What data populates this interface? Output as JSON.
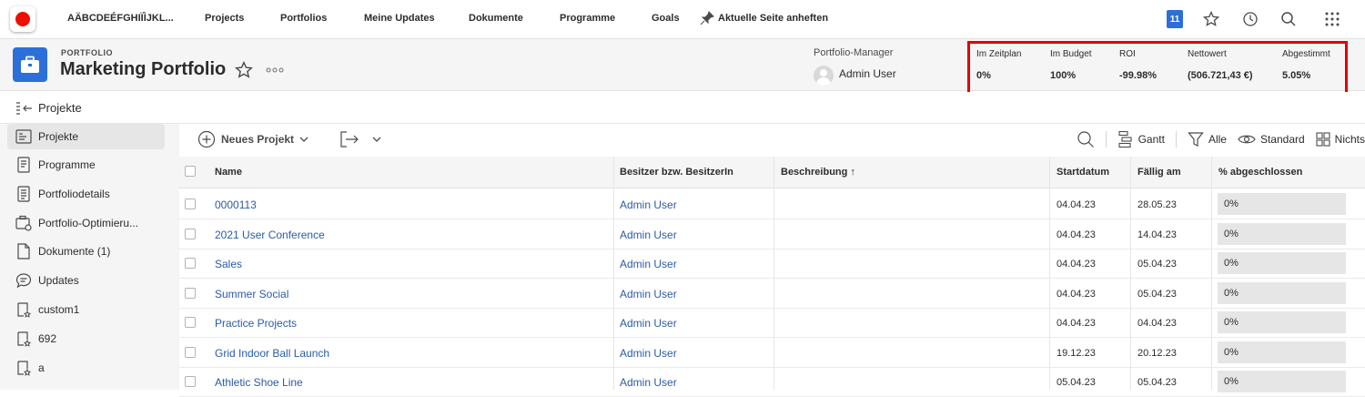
{
  "topnav": {
    "account": "AÄBCDEÉFGHIÏÌJKL...",
    "items": [
      "Projects",
      "Portfolios",
      "Meine Updates",
      "Dokumente",
      "Programme",
      "Goals"
    ],
    "pin_label": "Aktuelle Seite anheften",
    "notification_count": "11"
  },
  "header": {
    "object_type": "PORTFOLIO",
    "title": "Marketing Portfolio",
    "manager_label": "Portfolio-Manager",
    "manager_name": "Admin User",
    "metrics": [
      {
        "label": "Im Zeitplan",
        "value": "0%"
      },
      {
        "label": "Im Budget",
        "value": "100%"
      },
      {
        "label": "ROI",
        "value": "-99.98%"
      },
      {
        "label": "Nettowert",
        "value": "(506.721,43 €)"
      },
      {
        "label": "Abgestimmt",
        "value": "5.05%"
      }
    ],
    "highlight_color": "#e30000"
  },
  "subheader": {
    "title": "Projekte"
  },
  "sidebar": {
    "items": [
      {
        "label": "Projekte",
        "icon": "projects-icon",
        "active": true
      },
      {
        "label": "Programme",
        "icon": "programs-icon",
        "active": false
      },
      {
        "label": "Portfoliodetails",
        "icon": "details-icon",
        "active": false
      },
      {
        "label": "Portfolio-Optimieru...",
        "icon": "optimizer-icon",
        "active": false
      },
      {
        "label": "Dokumente (1)",
        "icon": "document-icon",
        "active": false
      },
      {
        "label": "Updates",
        "icon": "comment-icon",
        "active": false
      },
      {
        "label": "custom1",
        "icon": "custom-page-icon",
        "active": false
      },
      {
        "label": "692",
        "icon": "custom-page-icon",
        "active": false
      },
      {
        "label": "a",
        "icon": "custom-page-icon",
        "active": false
      }
    ]
  },
  "toolbar": {
    "new_project": "Neues Projekt",
    "gantt": "Gantt",
    "filter": "Alle",
    "view": "Standard",
    "grouping": "Nichts"
  },
  "table": {
    "headers": [
      "Name",
      "Besitzer bzw. BesitzerIn",
      "Beschreibung ↑",
      "Startdatum",
      "Fällig am",
      "% abgeschlossen"
    ],
    "rows": [
      {
        "name": "0000113",
        "owner": "Admin User",
        "description": "",
        "start": "04.04.23",
        "due": "28.05.23",
        "percent": "0%"
      },
      {
        "name": "2021 User Conference",
        "owner": "Admin User",
        "description": "",
        "start": "04.04.23",
        "due": "14.04.23",
        "percent": "0%"
      },
      {
        "name": "Sales",
        "owner": "Admin User",
        "description": "",
        "start": "04.04.23",
        "due": "05.04.23",
        "percent": "0%"
      },
      {
        "name": "Summer Social",
        "owner": "Admin User",
        "description": "",
        "start": "04.04.23",
        "due": "05.04.23",
        "percent": "0%"
      },
      {
        "name": "Practice Projects",
        "owner": "Admin User",
        "description": "",
        "start": "04.04.23",
        "due": "04.04.23",
        "percent": "0%"
      },
      {
        "name": "Grid Indoor Ball Launch",
        "owner": "Admin User",
        "description": "",
        "start": "19.12.23",
        "due": "20.12.23",
        "percent": "0%"
      },
      {
        "name": "Athletic Shoe Line",
        "owner": "Admin User",
        "description": "",
        "start": "05.04.23",
        "due": "05.04.23",
        "percent": "0%"
      }
    ]
  },
  "colors": {
    "brand": "#eb1000",
    "accent": "#2d6fd9",
    "link": "#2b5ba7"
  }
}
